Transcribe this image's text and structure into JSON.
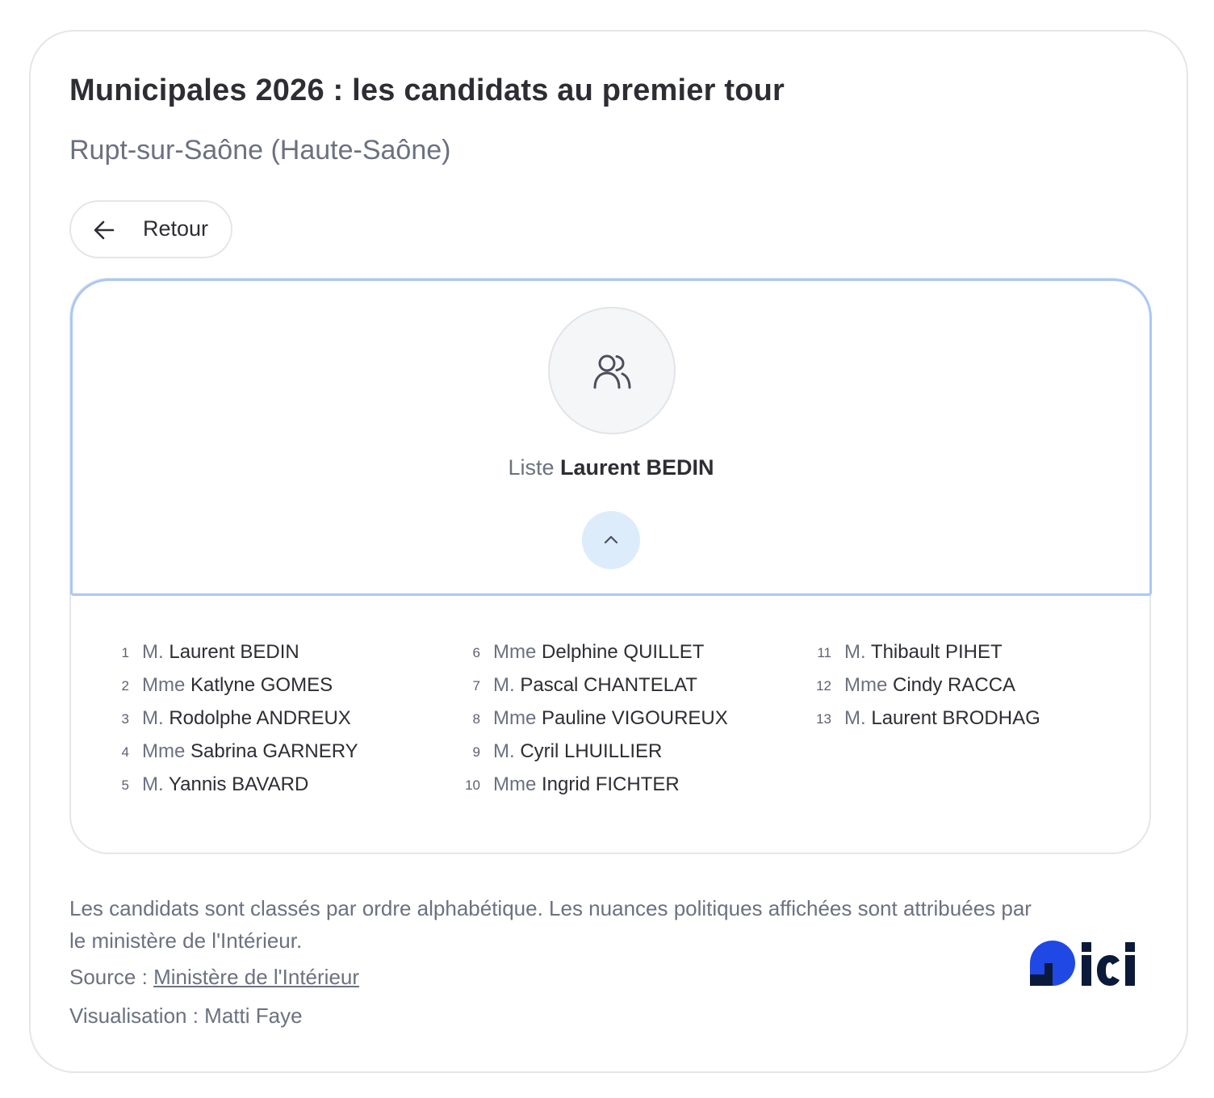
{
  "header": {
    "title": "Municipales 2026 : les candidats au premier tour",
    "subtitle": "Rupt-sur-Saône (Haute-Saône)"
  },
  "back_button": {
    "label": "Retour",
    "icon": "arrow-left-icon"
  },
  "list": {
    "icon": "users-icon",
    "prefix": "Liste",
    "name": "Laurent BEDIN",
    "toggle_icon": "chevron-up-icon",
    "candidates": [
      {
        "num": "1",
        "civ": "M.",
        "name": "Laurent BEDIN"
      },
      {
        "num": "2",
        "civ": "Mme",
        "name": "Katlyne GOMES"
      },
      {
        "num": "3",
        "civ": "M.",
        "name": "Rodolphe ANDREUX"
      },
      {
        "num": "4",
        "civ": "Mme",
        "name": "Sabrina GARNERY"
      },
      {
        "num": "5",
        "civ": "M.",
        "name": "Yannis BAVARD"
      },
      {
        "num": "6",
        "civ": "Mme",
        "name": "Delphine QUILLET"
      },
      {
        "num": "7",
        "civ": "M.",
        "name": "Pascal CHANTELAT"
      },
      {
        "num": "8",
        "civ": "Mme",
        "name": "Pauline VIGOUREUX"
      },
      {
        "num": "9",
        "civ": "M.",
        "name": "Cyril LHUILLIER"
      },
      {
        "num": "10",
        "civ": "Mme",
        "name": "Ingrid FICHTER"
      },
      {
        "num": "11",
        "civ": "M.",
        "name": "Thibault PIHET"
      },
      {
        "num": "12",
        "civ": "Mme",
        "name": "Cindy RACCA"
      },
      {
        "num": "13",
        "civ": "M.",
        "name": "Laurent BRODHAG"
      }
    ]
  },
  "footer": {
    "note": "Les candidats sont classés par ordre alphabétique. Les nuances politiques affichées sont attribuées par le ministère de l'Intérieur.",
    "source_label": "Source : ",
    "source_link": "Ministère de l'Intérieur",
    "viz": "Visualisation : Matti Faye",
    "logo_text": "ici"
  },
  "colors": {
    "accent_border": "#a9c8f5",
    "toggle_bg": "#dcecfb",
    "logo_blue": "#1f48e5",
    "logo_dark": "#0b1a3a"
  }
}
